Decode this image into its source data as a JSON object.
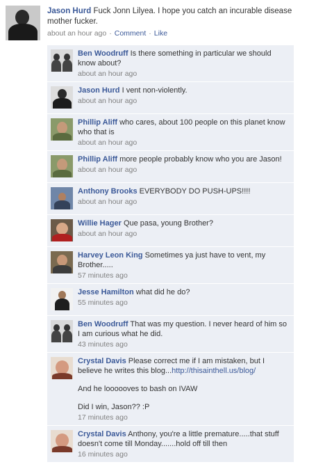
{
  "post": {
    "author": "Jason Hurd",
    "text": "Fuck Jonn Lilyea. I hope you catch an incurable disease mother fucker.",
    "time": "about an hour ago",
    "comment_label": "Comment",
    "like_label": "Like",
    "separator": "·"
  },
  "comments": [
    {
      "author": "Ben Woodruff",
      "text": "Is there something in particular we should know about?",
      "time": "about an hour ago"
    },
    {
      "author": "Jason Hurd",
      "text": "I vent non-violently.",
      "time": "about an hour ago"
    },
    {
      "author": "Phillip Aliff",
      "text": "who cares, about 100 people on this planet know who that is",
      "time": "about an hour ago"
    },
    {
      "author": "Phillip Aliff",
      "text": "more people probably know who you are Jason!",
      "time": "about an hour ago"
    },
    {
      "author": "Anthony Brooks",
      "text": "EVERYBODY DO PUSH-UPS!!!!",
      "time": "about an hour ago"
    },
    {
      "author": "Willie Hager",
      "text": "Que pasa, young Brother?",
      "time": "about an hour ago"
    },
    {
      "author": "Harvey Leon King",
      "text": "Sometimes ya just have to vent, my Brother.....",
      "time": "57 minutes ago"
    },
    {
      "author": "Jesse Hamilton",
      "text": "what did he do?",
      "time": "55 minutes ago"
    },
    {
      "author": "Ben Woodruff",
      "text": "That was my question. I never heard of him so I am curious what he did.",
      "time": "43 minutes ago"
    },
    {
      "author": "Crystal Davis",
      "text": "Please correct me if I am mistaken, but I believe he writes this blog...",
      "link": "http://thisainthell.us/blog/",
      "text2": "And he loooooves to bash on IVAW",
      "text3": "Did I win, Jason?? :P",
      "time": "17 minutes ago"
    },
    {
      "author": "Crystal Davis",
      "text": "Anthony, you're a little premature.....that stuff doesn't come till Monday.......hold off till then",
      "time": "16 minutes ago"
    }
  ]
}
